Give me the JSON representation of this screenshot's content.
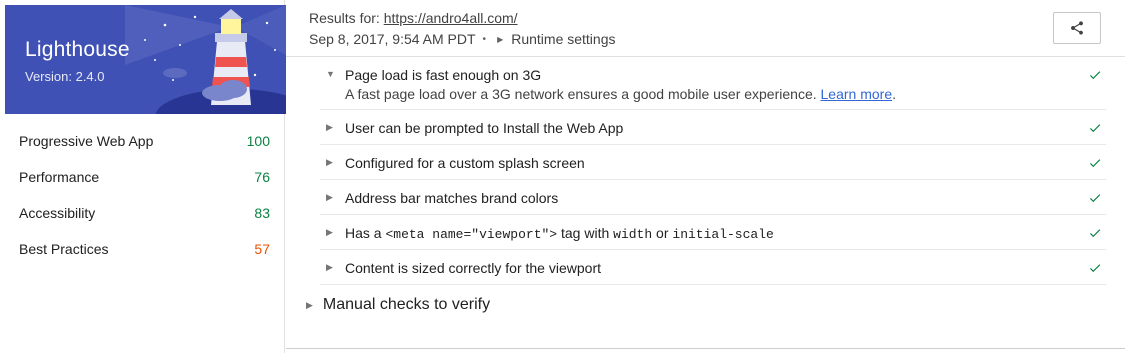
{
  "brand": {
    "title": "Lighthouse",
    "version": "Version: 2.4.0",
    "banner_color": "#3f51b5"
  },
  "categories": [
    {
      "label": "Progressive Web App",
      "score": "100",
      "color": "#0b8043"
    },
    {
      "label": "Performance",
      "score": "76",
      "color": "#0b8043"
    },
    {
      "label": "Accessibility",
      "score": "83",
      "color": "#0b8043"
    },
    {
      "label": "Best Practices",
      "score": "57",
      "color": "#e65100"
    }
  ],
  "header": {
    "results_prefix": "Results for:",
    "url": "https://andro4all.com/",
    "timestamp": "Sep 8, 2017, 9:54 AM PDT",
    "runtime_label": "Runtime settings",
    "share_icon": "share-icon"
  },
  "audits": {
    "expanded": {
      "title": "Page load is fast enough on 3G",
      "description": "A fast page load over a 3G network ensures a good mobile user experience.",
      "learn_more": "Learn more",
      "period": "."
    },
    "install": "User can be prompted to Install the Web App",
    "splash": "Configured for a custom splash screen",
    "brand_colors": "Address bar matches brand colors",
    "viewport": {
      "has_a": "Has a",
      "meta_tag": "<meta name=\"viewport\">",
      "tag_with": "tag with",
      "width": "width",
      "or": "or",
      "initial_scale": "initial-scale"
    },
    "content_sized": "Content is sized correctly for the viewport",
    "pass_color": "#0b8043"
  },
  "manual": {
    "label": "Manual checks to verify"
  }
}
